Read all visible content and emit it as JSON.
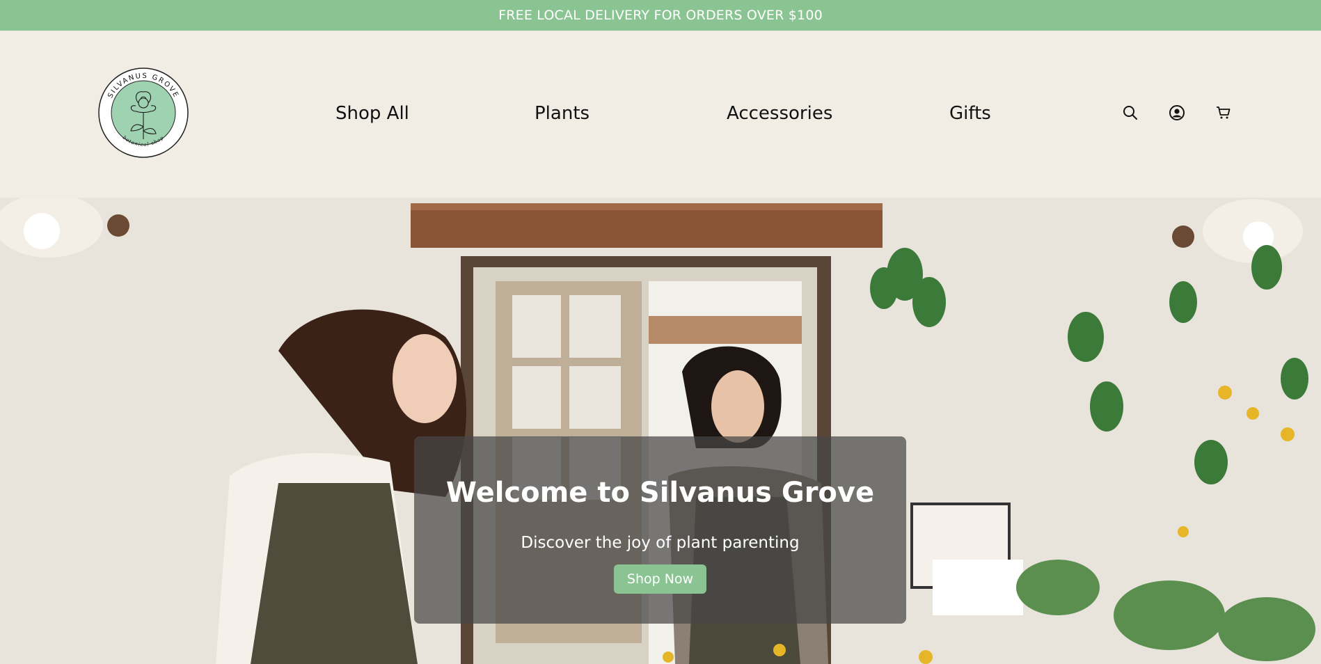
{
  "announcement": {
    "text": "FREE LOCAL DELIVERY FOR ORDERS OVER $100"
  },
  "logo": {
    "top_text": "SILVANUS GROVE",
    "bottom_text": "botanical shop",
    "icon": "peony-flower-icon"
  },
  "nav": {
    "items": [
      {
        "label": "Shop All"
      },
      {
        "label": "Plants"
      },
      {
        "label": "Accessories"
      },
      {
        "label": "Gifts"
      }
    ]
  },
  "header_icons": [
    {
      "name": "search-icon"
    },
    {
      "name": "account-icon"
    },
    {
      "name": "cart-icon"
    }
  ],
  "hero": {
    "title": "Welcome to Silvanus Grove",
    "subtitle": "Discover the joy of plant parenting",
    "cta_label": "Shop Now"
  },
  "colors": {
    "accent": "#8bc493",
    "header_bg": "#f1ece4",
    "overlay": "#464646"
  }
}
